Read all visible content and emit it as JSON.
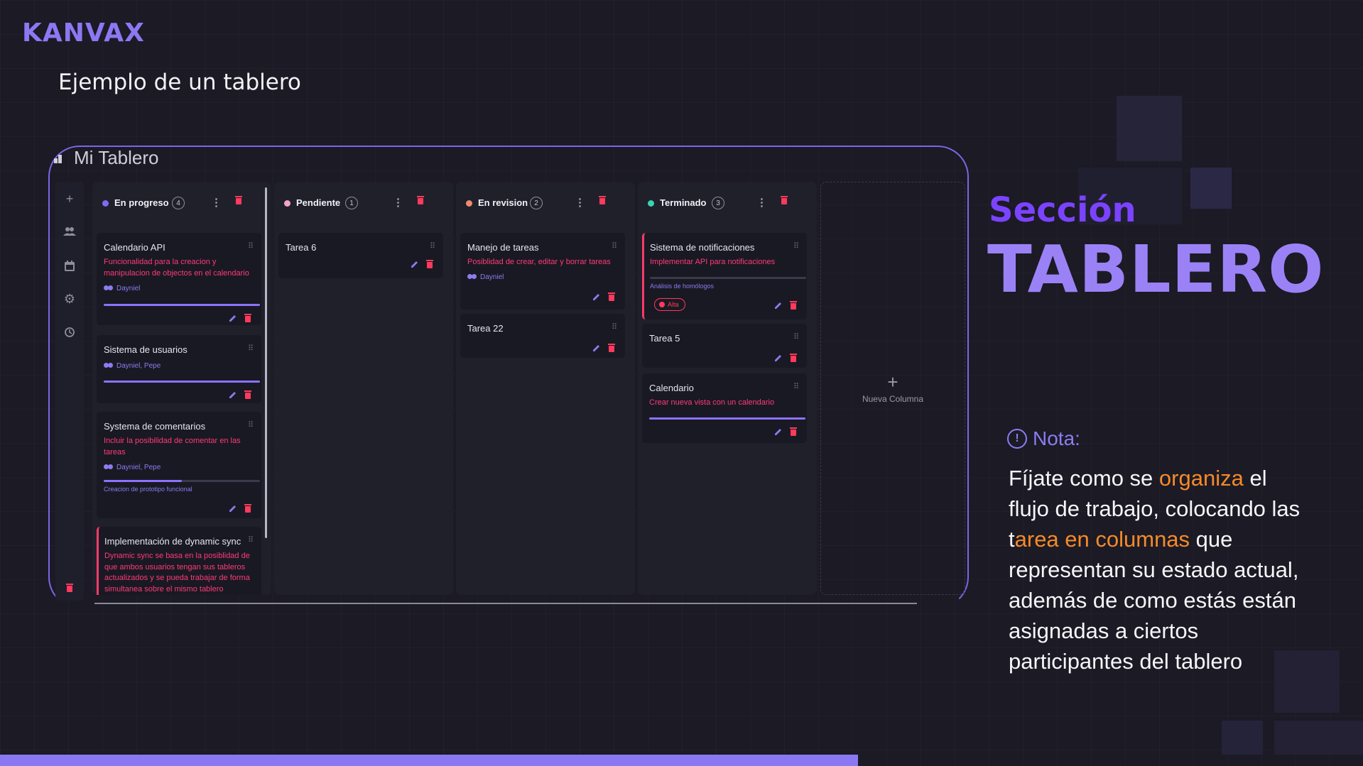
{
  "brand": {
    "logo": "KANVAX"
  },
  "slide": {
    "subtitle": "Ejemplo de un tablero"
  },
  "board": {
    "title": "Mi Tablero",
    "columns": [
      {
        "name": "En progreso",
        "count": "4",
        "color": "#7b6cf6",
        "cards": [
          {
            "title": "Calendario API",
            "description": "Funcionalidad para la creacion y manipulacion de objectos en el calendario",
            "users": "Dayniel",
            "progress": 1.0
          },
          {
            "title": "Sistema de usuarios",
            "users": "Dayniel, Pepe",
            "progress": 1.0
          },
          {
            "title": "Systema de comentarios",
            "description": "Incluir la posibilidad de comentar en las tareas",
            "users": "Dayniel, Pepe",
            "progress": 0.5,
            "subtask": "Creacion de prototipo funcional"
          },
          {
            "title": "Implementación de dynamic sync",
            "description": "Dynamic sync se basa en la posiblidad de que ambos usuarios tengan sus tableros actualizados y se pueda trabajar de forma simultanea sobre el mismo tablero"
          }
        ]
      },
      {
        "name": "Pendiente",
        "count": "1",
        "color": "#f4a3c8",
        "cards": [
          {
            "title": "Tarea 6"
          }
        ]
      },
      {
        "name": "En revision",
        "count": "2",
        "color": "#f08a6a",
        "cards": [
          {
            "title": "Manejo de tareas",
            "description": "Posiblidad de crear, editar y borrar tareas",
            "users": "Dayniel"
          },
          {
            "title": "Tarea 22"
          }
        ]
      },
      {
        "name": "Terminado",
        "count": "3",
        "color": "#36d4b0",
        "cards": [
          {
            "title": "Sistema de notificaciones",
            "description": "Implementar API para notificaciones",
            "subtask": "Análisis de homólogos",
            "priority": "Alta",
            "progress": 0.0
          },
          {
            "title": "Tarea 5"
          },
          {
            "title": "Calendario",
            "description": "Crear nueva vista con un calendario",
            "progress": 1.0
          }
        ]
      }
    ],
    "new_column_label": "Nueva Columna"
  },
  "section": {
    "label": "Sección",
    "title": "TABLERO"
  },
  "note": {
    "label": "Nota:",
    "parts": [
      "Fíjate como se ",
      "organiza",
      " el flujo de trabajo, colocando las t",
      "area en columnas",
      " que representan su estado actual, además de como estás están asignadas a ciertos participantes del tablero"
    ]
  },
  "colors": {
    "accent": "#8a78f2",
    "danger": "#ff3a5c",
    "highlight": "#f68a28",
    "section_label": "#7b43ff"
  },
  "icons": [
    "add-icon",
    "people-icon",
    "calendar-icon",
    "gear-icon",
    "history-icon",
    "trash-icon",
    "edit-icon",
    "drag-handle-icon",
    "more-vert-icon",
    "alert-circle-icon"
  ]
}
